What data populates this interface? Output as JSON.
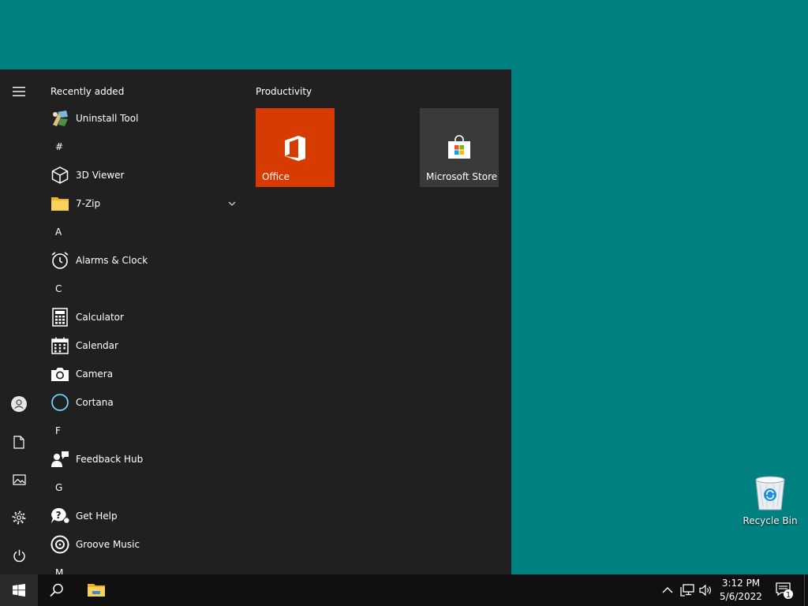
{
  "start_menu": {
    "rail": {
      "menu_icon": "hamburger-icon",
      "user_icon": "user-icon",
      "documents_icon": "document-icon",
      "pictures_icon": "pictures-icon",
      "settings_icon": "gear-icon",
      "power_icon": "power-icon"
    },
    "app_list": {
      "header": "Recently added",
      "items": [
        {
          "type": "app",
          "label": "Uninstall Tool",
          "icon": "uninstall-tool-icon"
        },
        {
          "type": "letter",
          "label": "#"
        },
        {
          "type": "app",
          "label": "3D Viewer",
          "icon": "cube-icon"
        },
        {
          "type": "app",
          "label": "7-Zip",
          "icon": "folder-icon",
          "expandable": true
        },
        {
          "type": "letter",
          "label": "A"
        },
        {
          "type": "app",
          "label": "Alarms & Clock",
          "icon": "alarm-clock-icon"
        },
        {
          "type": "letter",
          "label": "C"
        },
        {
          "type": "app",
          "label": "Calculator",
          "icon": "calculator-icon"
        },
        {
          "type": "app",
          "label": "Calendar",
          "icon": "calendar-icon"
        },
        {
          "type": "app",
          "label": "Camera",
          "icon": "camera-icon"
        },
        {
          "type": "app",
          "label": "Cortana",
          "icon": "cortana-icon"
        },
        {
          "type": "letter",
          "label": "F"
        },
        {
          "type": "app",
          "label": "Feedback Hub",
          "icon": "feedback-hub-icon"
        },
        {
          "type": "letter",
          "label": "G"
        },
        {
          "type": "app",
          "label": "Get Help",
          "icon": "help-icon"
        },
        {
          "type": "app",
          "label": "Groove Music",
          "icon": "music-disc-icon"
        },
        {
          "type": "letter",
          "label": "M"
        }
      ]
    },
    "tiles": {
      "group_title": "Productivity",
      "office": {
        "label": "Office",
        "color": "#d83b01",
        "icon": "office-icon"
      },
      "store": {
        "label": "Microsoft Store",
        "color": "#3a3a3a",
        "icon": "store-bag-icon"
      }
    }
  },
  "desktop": {
    "recycle_bin_label": "Recycle Bin"
  },
  "taskbar": {
    "start_icon": "windows-logo-icon",
    "search_icon": "search-icon",
    "explorer_icon": "file-explorer-icon",
    "tray": {
      "chevron_icon": "chevron-up-icon",
      "network_icon": "network-icon",
      "volume_icon": "volume-icon",
      "time": "3:12 PM",
      "date": "5/6/2022",
      "notification_icon": "action-center-icon",
      "notification_count": "1"
    }
  },
  "colors": {
    "desktop": "#008080",
    "menu_bg": "#202020",
    "taskbar_bg": "#101010",
    "office_tile": "#d83b01",
    "cortana_accent": "#2aa8e0"
  }
}
